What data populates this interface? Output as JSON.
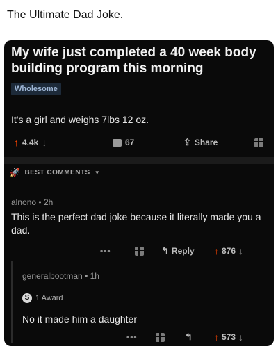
{
  "caption": "The Ultimate Dad Joke.",
  "post": {
    "title": "My wife just completed a 40 week body building program this morning",
    "flair": "Wholesome",
    "body": "It's a girl and weighs 7lbs 12 oz.",
    "votes": "4.4k",
    "comments": "67",
    "share_label": "Share"
  },
  "sort_label": "BEST COMMENTS",
  "comments": [
    {
      "author": "alnono",
      "age": "2h",
      "body": "This is the perfect dad joke because it literally made you a dad.",
      "reply_label": "Reply",
      "votes": "876"
    },
    {
      "author": "generalbootman",
      "age": "1h",
      "award": "1 Award",
      "body": "No it made him a daughter",
      "votes": "573"
    }
  ],
  "colors": {
    "upvote": "#ff4500",
    "background": "#0a0a0a",
    "flair_bg": "#1d2a39"
  },
  "icons": [
    "upvote-icon",
    "downvote-icon",
    "comment-icon",
    "share-icon",
    "gift-icon",
    "rocket-icon",
    "reply-icon",
    "more-icon",
    "award-icon"
  ]
}
